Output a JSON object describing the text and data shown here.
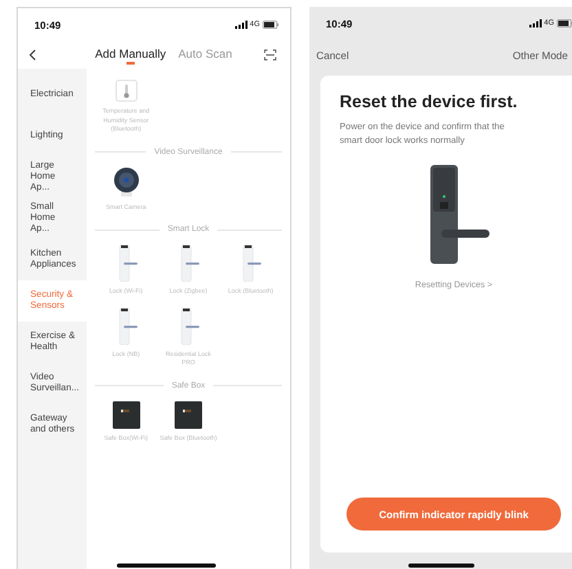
{
  "left_phone": {
    "status_bar": {
      "time": "10:49",
      "network": "4G"
    },
    "tabs": [
      {
        "label": "Add Manually",
        "selected": true
      },
      {
        "label": "Auto Scan",
        "selected": false
      }
    ],
    "sidebar": {
      "items": [
        {
          "label": "Electrician",
          "selected": false
        },
        {
          "label": "Lighting",
          "selected": false
        },
        {
          "label": "Large Home Ap...",
          "selected": false
        },
        {
          "label": "Small Home Ap...",
          "selected": false
        },
        {
          "label": "Kitchen Appliances",
          "selected": false
        },
        {
          "label": "Security & Sensors",
          "selected": true
        },
        {
          "label": "Exercise & Health",
          "selected": false
        },
        {
          "label": "Video Surveillan...",
          "selected": false
        },
        {
          "label": "Gateway and others",
          "selected": false
        }
      ]
    },
    "sections": [
      {
        "devices": [
          {
            "kind": "thermometer",
            "label": "Temperature and Humidity Sensor (Bluetooth)"
          }
        ]
      },
      {
        "title": "Video Surveillance",
        "devices": [
          {
            "kind": "camera",
            "label": "Smart Camera"
          }
        ]
      },
      {
        "title": "Smart Lock",
        "devices": [
          {
            "kind": "lock",
            "label": "Lock (Wi-Fi)"
          },
          {
            "kind": "lock",
            "label": "Lock (Zigbee)"
          },
          {
            "kind": "lock",
            "label": "Lock (Bluetooth)"
          },
          {
            "kind": "lock",
            "label": "Lock (NB)"
          },
          {
            "kind": "lock",
            "label": "Residential Lock PRO"
          }
        ]
      },
      {
        "title": "Safe Box",
        "devices": [
          {
            "kind": "safe",
            "label": "Safe Box(Wi-Fi)"
          },
          {
            "kind": "safe",
            "label": "Safe Box (Bluetooth)"
          }
        ]
      }
    ]
  },
  "right_phone": {
    "status_bar": {
      "time": "10:49",
      "network": "4G"
    },
    "cancel": "Cancel",
    "other_mode": "Other Mode",
    "title": "Reset the device first.",
    "description": "Power on the device and confirm that the smart door lock works normally",
    "link": "Resetting Devices >",
    "button": "Confirm indicator rapidly blink"
  }
}
